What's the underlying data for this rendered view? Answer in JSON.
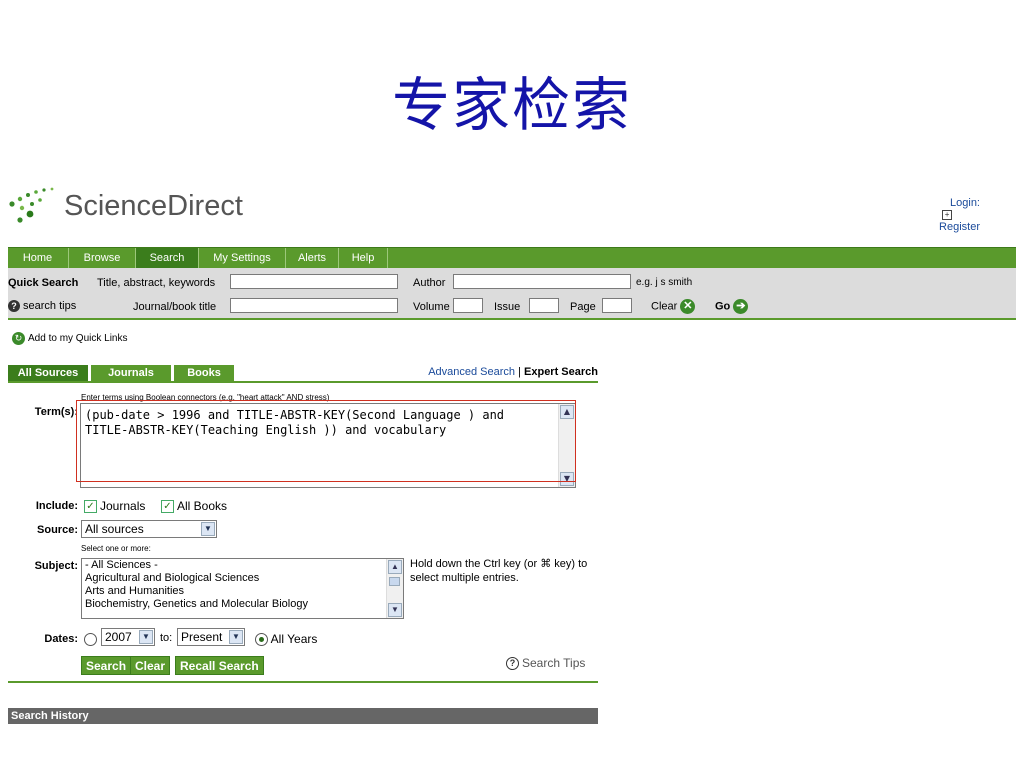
{
  "slide_title": "专家检索",
  "logo": {
    "text": "ScienceDirect"
  },
  "account": {
    "login": "Login:",
    "register": "Register"
  },
  "nav": {
    "items": [
      "Home",
      "Browse",
      "Search",
      "My Settings",
      "Alerts",
      "Help"
    ],
    "active": "Search"
  },
  "quick_search": {
    "heading": "Quick Search",
    "title_label": "Title, abstract, keywords",
    "author_label": "Author",
    "author_example": "e.g. j s smith",
    "tips_label": "search tips",
    "journal_label": "Journal/book title",
    "volume_label": "Volume",
    "issue_label": "Issue",
    "page_label": "Page",
    "clear_label": "Clear",
    "go_label": "Go"
  },
  "quick_links": "Add to my Quick Links",
  "tabs": [
    "All Sources",
    "Journals",
    "Books"
  ],
  "search_links": {
    "advanced": "Advanced Search",
    "separator": "|",
    "expert": "Expert Search"
  },
  "form": {
    "hint": "Enter terms using Boolean connectors (e.g. \"heart attack\" AND stress)",
    "terms_label": "Term(s):",
    "terms_value": "(pub-date > 1996 and TITLE-ABSTR-KEY(Second Language ) and\nTITLE-ABSTR-KEY(Teaching English )) and vocabulary",
    "include_label": "Include:",
    "include_options": [
      "Journals",
      "All Books"
    ],
    "source_label": "Source:",
    "source_value": "All sources",
    "select_hint": "Select one or more:",
    "subject_label": "Subject:",
    "subjects": [
      "- All Sciences -",
      "Agricultural and Biological Sciences",
      "Arts and Humanities",
      "Biochemistry, Genetics and Molecular Biology"
    ],
    "subject_help": "Hold down the Ctrl key (or ⌘ key) to select multiple entries.",
    "dates_label": "Dates:",
    "date_from": "2007",
    "date_to_label": "to:",
    "date_to": "Present",
    "all_years": "All Years"
  },
  "buttons": {
    "search": "Search",
    "clear": "Clear",
    "recall": "Recall Search"
  },
  "search_tips": "Search Tips",
  "history_title": "Search History",
  "colors": {
    "title": "#1414a8",
    "nav_green": "#5a9a2c",
    "nav_active": "#3b7d1c",
    "highlight_box": "#d03020"
  }
}
